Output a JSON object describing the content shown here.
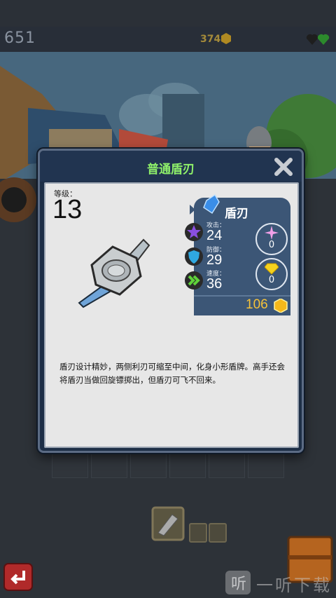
{
  "hud": {
    "score": "651",
    "coins": "374",
    "coin_icon": "gold-coin-icon",
    "hearts_icon": "broken-heart-and-heart-icon"
  },
  "dialog": {
    "title": "普通盾刃",
    "close_icon": "close-x-icon",
    "level_label": "等级：",
    "level_value": "13",
    "item_name": "盾刃",
    "stats": [
      {
        "label": "攻击：",
        "value": "24",
        "icon": "attack-star-icon"
      },
      {
        "label": "防御：",
        "value": "29",
        "icon": "defense-shield-icon"
      },
      {
        "label": "速度：",
        "value": "36",
        "icon": "speed-chevron-icon"
      }
    ],
    "gem_slots": [
      {
        "icon": "pink-sparkle-gem-icon",
        "value": "0"
      },
      {
        "icon": "yellow-diamond-gem-icon",
        "value": "0"
      }
    ],
    "price": "106",
    "price_icon": "gold-gem-icon",
    "description": "盾刃设计精妙，两侧利刃可缩至中间，化身小形盾牌。高手还会将盾刃当做回旋镖掷出，但盾刃可飞不回来。"
  },
  "watermark": {
    "text": "一听下载"
  },
  "colors": {
    "title_green": "#8ff06a",
    "panel_bg": "#e7e7e7",
    "stats_card": "#3c5676",
    "price_gold": "#f5c23a"
  }
}
